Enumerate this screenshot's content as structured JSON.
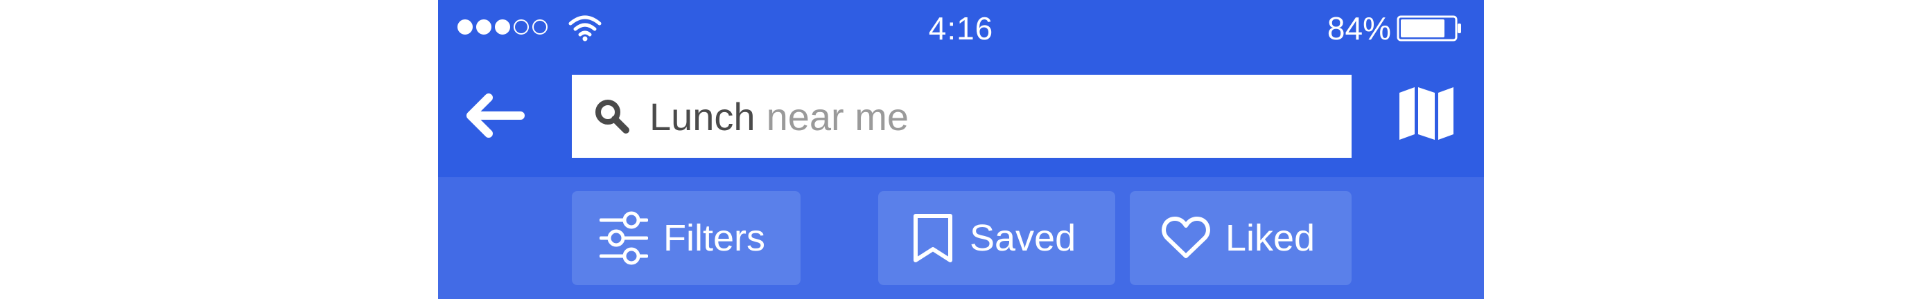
{
  "status_bar": {
    "time": "4:16",
    "battery_percent": "84%",
    "signal_bars_filled": 3,
    "signal_bars_total": 5,
    "battery_level": 0.84
  },
  "search": {
    "query": "Lunch",
    "hint": "near me"
  },
  "filters": {
    "filters_label": "Filters",
    "saved_label": "Saved",
    "liked_label": "Liked"
  },
  "icons": [
    "back-arrow-icon",
    "search-icon",
    "map-icon",
    "sliders-icon",
    "bookmark-icon",
    "heart-icon",
    "wifi-icon",
    "battery-icon"
  ],
  "colors": {
    "nav_background": "#2f5de3",
    "filter_strip_background": "#426be6",
    "chip_background": "#5a80ea"
  }
}
